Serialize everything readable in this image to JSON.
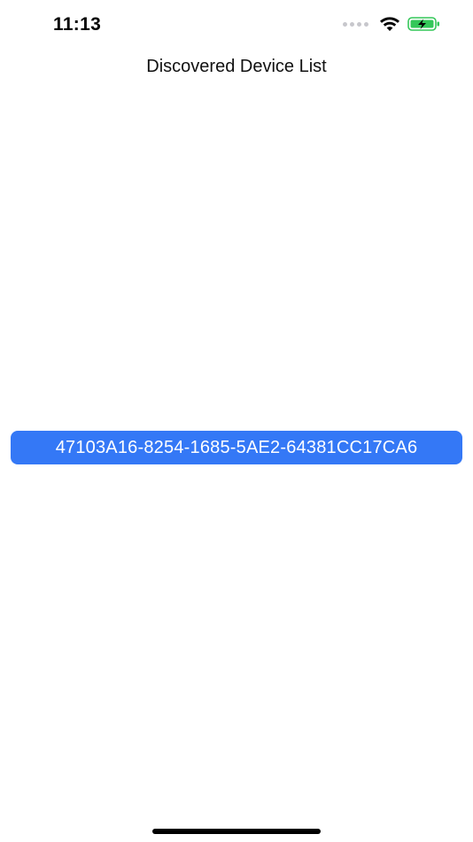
{
  "status_bar": {
    "time": "11:13",
    "battery_color": "#34c759",
    "icons": [
      "cellular-signal-icon",
      "wifi-icon",
      "battery-charging-icon"
    ]
  },
  "nav": {
    "title": "Discovered Device List"
  },
  "devices": [
    {
      "id": "47103A16-8254-1685-5AE2-64381CC17CA6"
    }
  ],
  "colors": {
    "accent": "#3478f6",
    "background": "#ffffff"
  }
}
